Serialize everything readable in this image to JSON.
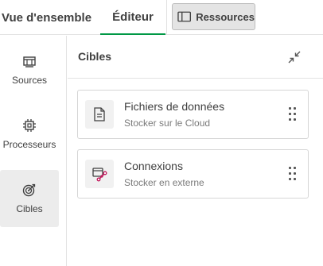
{
  "tabs": {
    "overview": "Vue d'ensemble",
    "editor": "Éditeur",
    "resources": "Ressources"
  },
  "rail": {
    "items": [
      {
        "label": "Sources",
        "icon": "sources-icon"
      },
      {
        "label": "Processeurs",
        "icon": "processor-chip-icon"
      },
      {
        "label": "Cibles",
        "icon": "target-icon"
      }
    ],
    "selected": "Cibles"
  },
  "panel": {
    "title": "Cibles",
    "collapse_icon": "collapse-arrows-icon"
  },
  "cards": [
    {
      "title": "Fichiers de données",
      "subtitle": "Stocker sur le Cloud",
      "icon": "document-icon"
    },
    {
      "title": "Connexions",
      "subtitle": "Stocker en externe",
      "icon": "connection-icon"
    }
  ],
  "colors": {
    "active_tab_underline": "#009845",
    "connection_icon": "#c2185b"
  }
}
